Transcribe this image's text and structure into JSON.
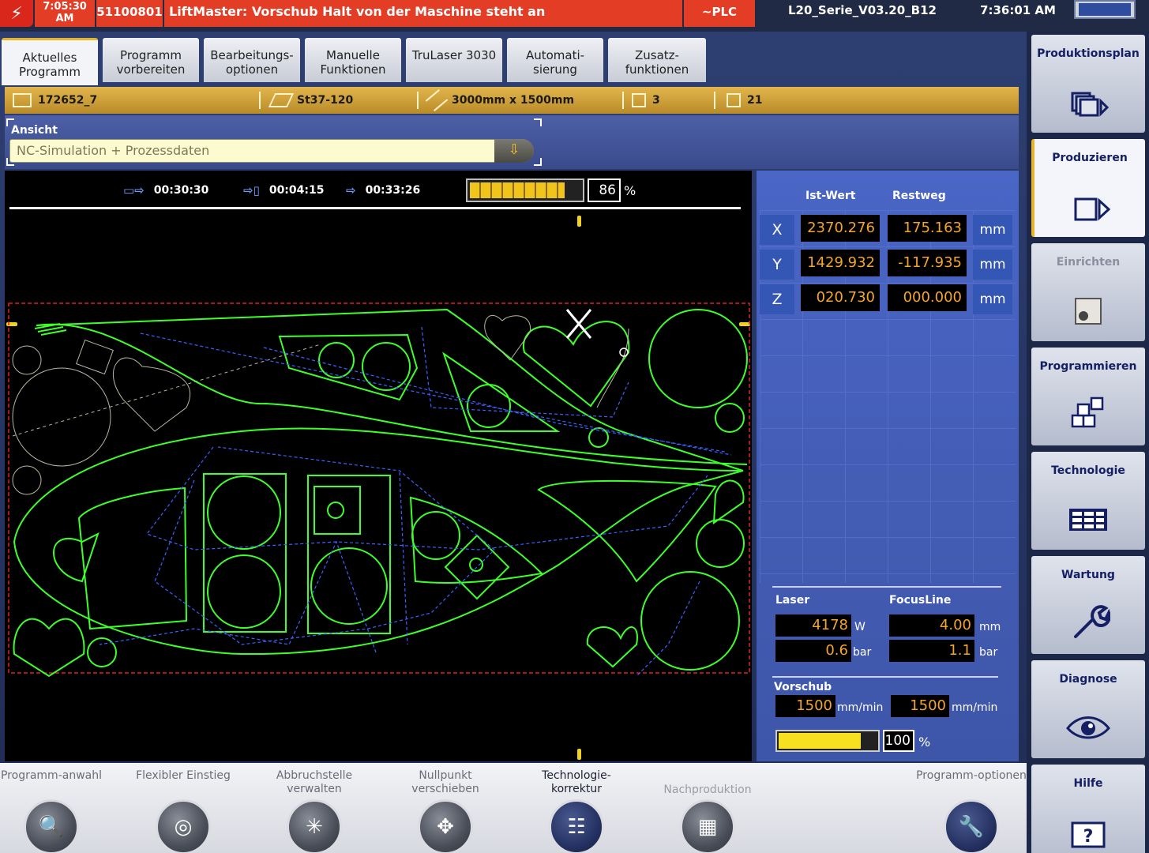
{
  "topbar": {
    "alarm_time": "7:05:30 AM",
    "message_number": "51100801",
    "message": "LiftMaster: Vorschub Halt von der Maschine steht an",
    "plc": "~PLC",
    "version": "L20_Serie_V03.20_B12",
    "clock": "7:36:01 AM",
    "alarm_color": "#e33d26"
  },
  "tabs": [
    {
      "label": "Aktuelles Programm",
      "active": true
    },
    {
      "label": "Programm vorbereiten"
    },
    {
      "label": "Bearbeitungs-optionen"
    },
    {
      "label": "Manuelle Funktionen"
    },
    {
      "label": "TruLaser 3030"
    },
    {
      "label": "Automati-sierung"
    },
    {
      "label": "Zusatz-funktionen"
    }
  ],
  "infobar": {
    "program": "172652_7",
    "material": "St37-120",
    "sheet_size": "3000mm x 1500mm",
    "count_a": "3",
    "count_b": "21"
  },
  "view": {
    "label": "Ansicht",
    "selected": "NC-Simulation + Prozessdaten"
  },
  "simulation": {
    "time_1": "00:30:30",
    "time_2": "00:04:15",
    "time_3": "00:33:26",
    "progress_percent": "86",
    "progress_unit": "%",
    "contour_color": "#3dff2a",
    "path_color": "#2f5bff",
    "sheet_border_color": "#e02020"
  },
  "axes": {
    "head_actual": "Ist-Wert",
    "head_rest": "Restweg",
    "rows": [
      {
        "axis": "X",
        "actual": "2370.276",
        "rest": "175.163",
        "unit": "mm"
      },
      {
        "axis": "Y",
        "actual": "1429.932",
        "rest": "-117.935",
        "unit": "mm"
      },
      {
        "axis": "Z",
        "actual": "020.730",
        "rest": "000.000",
        "unit": "mm"
      }
    ]
  },
  "laser": {
    "title": "Laser",
    "power": "4178",
    "power_unit": "W",
    "pressure": "0.6",
    "pressure_unit": "bar"
  },
  "focusline": {
    "title": "FocusLine",
    "focus": "4.00",
    "focus_unit": "mm",
    "pressure": "1.1",
    "pressure_unit": "bar"
  },
  "feed": {
    "title": "Vorschub",
    "value_1": "1500",
    "unit_1": "mm/min",
    "value_2": "1500",
    "unit_2": "mm/min",
    "override": "100",
    "override_unit": "%"
  },
  "sidemenu": [
    {
      "label": "Produktionsplan",
      "icon": "production-plan-icon"
    },
    {
      "label": "Produzieren",
      "icon": "produce-icon",
      "active": true
    },
    {
      "label": "Einrichten",
      "icon": "setup-icon",
      "disabled": true
    },
    {
      "label": "Programmieren",
      "icon": "programming-icon"
    },
    {
      "label": "Technologie",
      "icon": "technology-icon"
    },
    {
      "label": "Wartung",
      "icon": "wrench-icon"
    },
    {
      "label": "Diagnose",
      "icon": "eye-icon"
    },
    {
      "label": "Hilfe",
      "icon": "help-icon"
    }
  ],
  "softkeys": [
    {
      "label": "Programm-anwahl",
      "icon": "program-select-icon"
    },
    {
      "label": "Flexibler Einstieg",
      "icon": "flexible-entry-icon"
    },
    {
      "label": "Abbruchstelle verwalten",
      "icon": "breakpoint-icon"
    },
    {
      "label": "Nullpunkt verschieben",
      "icon": "zero-point-icon"
    },
    {
      "label": "Technologie-korrektur",
      "icon": "technology-correction-icon"
    },
    {
      "label": "Nachproduktion",
      "icon": "reproduction-icon"
    },
    {
      "label": "Programm-optionen",
      "icon": "program-options-icon"
    }
  ]
}
